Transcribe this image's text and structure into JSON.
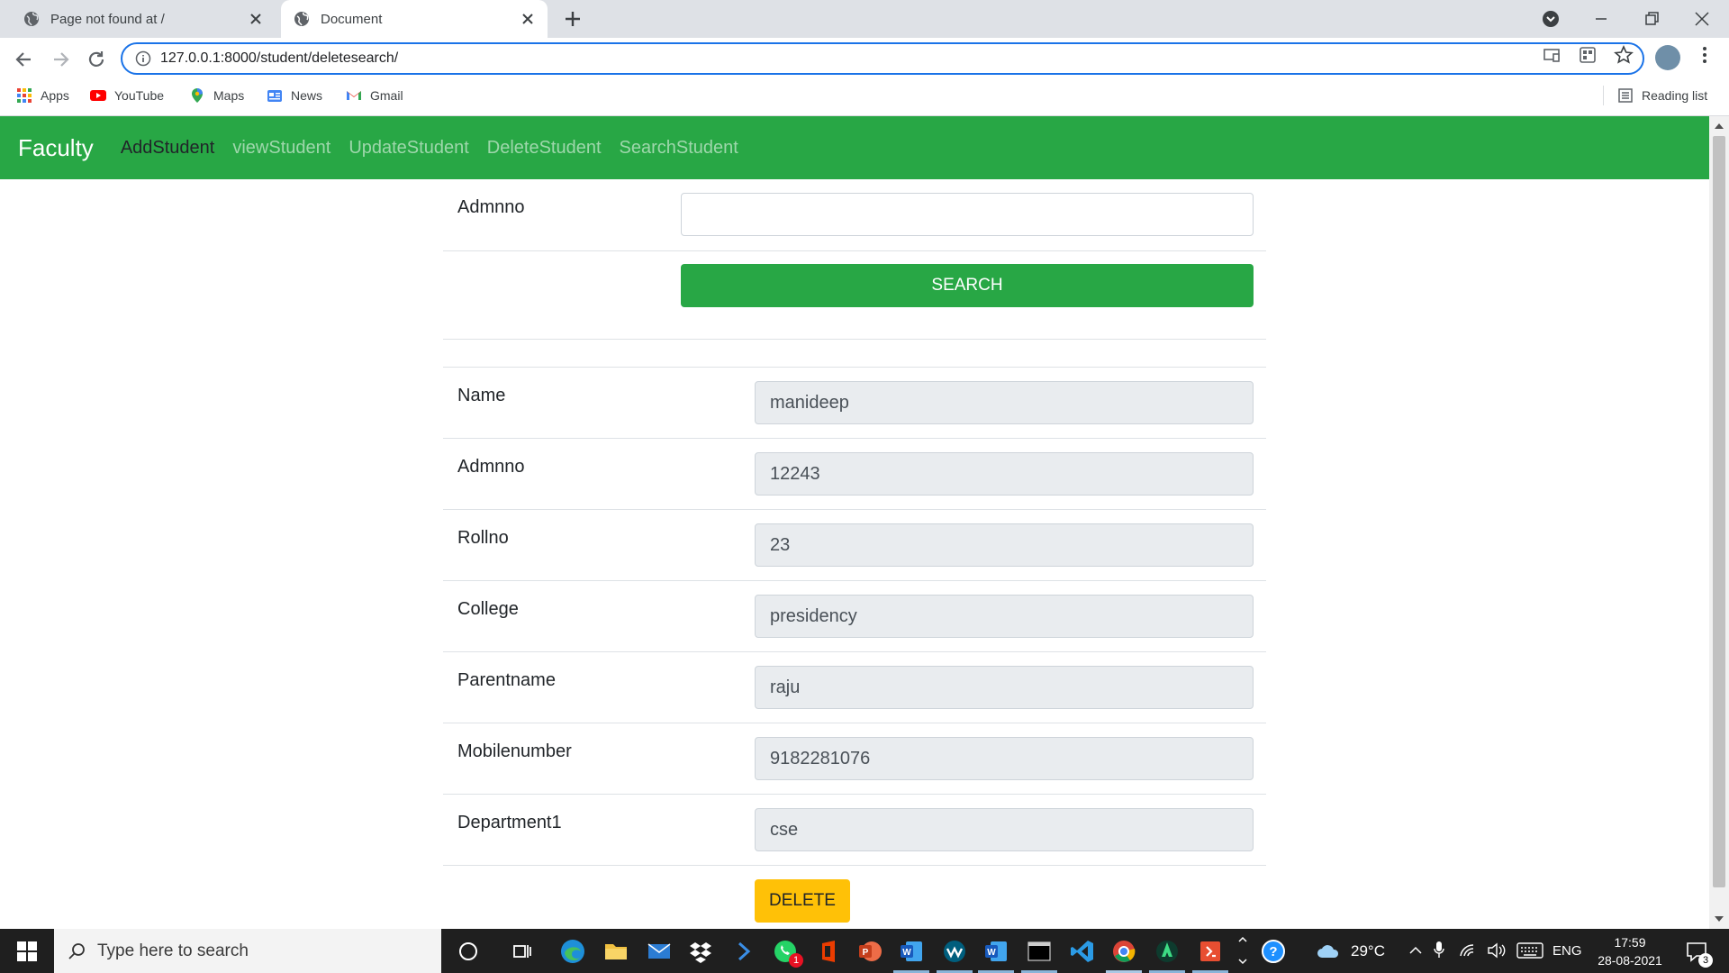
{
  "browser": {
    "tabs": [
      {
        "title": "Page not found at /",
        "active": false
      },
      {
        "title": "Document",
        "active": true
      }
    ],
    "url": "127.0.0.1:8000/student/deletesearch/",
    "bookmarks": [
      {
        "label": "Apps",
        "icon": "apps-grid-icon"
      },
      {
        "label": "YouTube",
        "icon": "youtube-icon"
      },
      {
        "label": "Maps",
        "icon": "maps-pin-icon"
      },
      {
        "label": "News",
        "icon": "news-icon"
      },
      {
        "label": "Gmail",
        "icon": "gmail-icon"
      }
    ],
    "reading_list": "Reading list"
  },
  "navbar": {
    "brand": "Faculty",
    "links": [
      "AddStudent",
      "viewStudent",
      "UpdateStudent",
      "DeleteStudent",
      "SearchStudent"
    ],
    "color": "#28a745"
  },
  "search_form": {
    "label": "Admnno",
    "value": "",
    "button": "SEARCH"
  },
  "student": {
    "fields": [
      {
        "label": "Name",
        "value": "manideep"
      },
      {
        "label": "Admnno",
        "value": "12243"
      },
      {
        "label": "Rollno",
        "value": "23"
      },
      {
        "label": "College",
        "value": "presidency"
      },
      {
        "label": "Parentname",
        "value": "raju"
      },
      {
        "label": "Mobilenumber",
        "value": "9182281076"
      },
      {
        "label": "Department1",
        "value": "cse"
      }
    ],
    "delete_button": "DELETE",
    "delete_color": "#ffc107"
  },
  "taskbar": {
    "search_placeholder": "Type here to search",
    "whatsapp_badge": "1",
    "weather": "29°C",
    "language": "ENG",
    "time": "17:59",
    "date": "28-08-2021",
    "notification_count": "3"
  }
}
